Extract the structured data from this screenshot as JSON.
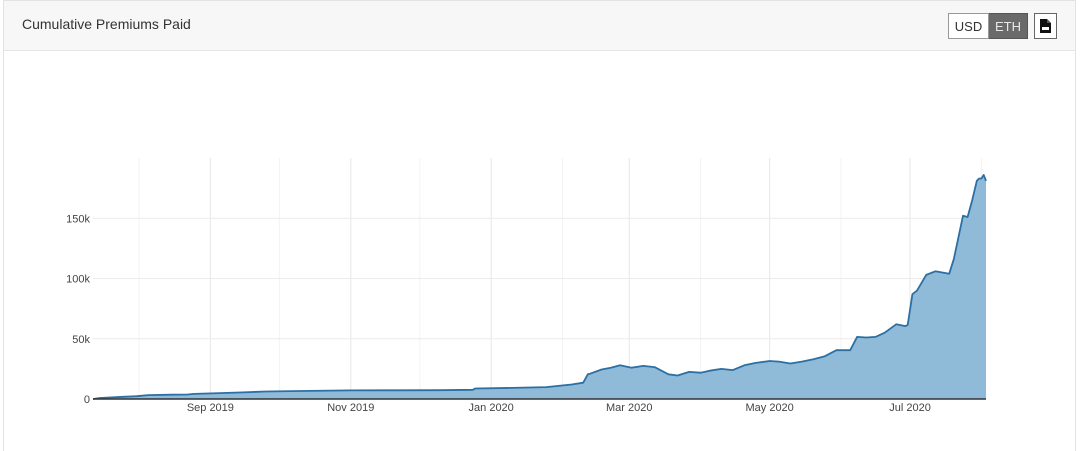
{
  "header": {
    "title": "Cumulative Premiums Paid",
    "currency_buttons": [
      {
        "label": "USD",
        "active": false
      },
      {
        "label": "ETH",
        "active": true
      }
    ],
    "csv_icon": "csv-file-icon"
  },
  "colors": {
    "area_fill": "#8fbbd9",
    "line": "#2c6fa3",
    "grid": "#ececec"
  },
  "chart_data": {
    "type": "area",
    "title": "",
    "xlabel": "",
    "ylabel": "",
    "x_tick_labels": [
      "Sep 2019",
      "Nov 2019",
      "Jan 2020",
      "Mar 2020",
      "May 2020",
      "Jul 2020"
    ],
    "y_tick_labels": [
      "0",
      "50k",
      "100k",
      "150k"
    ],
    "y_ticks": [
      0,
      50000,
      100000,
      150000
    ],
    "ylim": [
      0,
      200000
    ],
    "xlim": [
      "2019-07-12",
      "2020-08-03"
    ],
    "grid": true,
    "series": [
      {
        "x": [
          "2019-07-12",
          "2019-07-15",
          "2019-07-20",
          "2019-07-25",
          "2019-07-31",
          "2019-08-05",
          "2019-08-15",
          "2019-08-22",
          "2019-08-25",
          "2019-09-05",
          "2019-09-15",
          "2019-09-25",
          "2019-10-10",
          "2019-11-01",
          "2019-11-20",
          "2019-12-10",
          "2019-12-24",
          "2019-12-25",
          "2020-01-10",
          "2020-01-25",
          "2020-02-05",
          "2020-02-10",
          "2020-02-12",
          "2020-02-13",
          "2020-02-18",
          "2020-02-22",
          "2020-02-26",
          "2020-03-02",
          "2020-03-07",
          "2020-03-12",
          "2020-03-18",
          "2020-03-22",
          "2020-03-27",
          "2020-04-01",
          "2020-04-05",
          "2020-04-10",
          "2020-04-15",
          "2020-04-20",
          "2020-04-25",
          "2020-05-01",
          "2020-05-05",
          "2020-05-10",
          "2020-05-15",
          "2020-05-20",
          "2020-05-25",
          "2020-05-30",
          "2020-06-05",
          "2020-06-08",
          "2020-06-12",
          "2020-06-16",
          "2020-06-20",
          "2020-06-25",
          "2020-06-29",
          "2020-06-30",
          "2020-07-02",
          "2020-07-04",
          "2020-07-08",
          "2020-07-12",
          "2020-07-15",
          "2020-07-18",
          "2020-07-20",
          "2020-07-24",
          "2020-07-26",
          "2020-07-28",
          "2020-07-30",
          "2020-07-31",
          "2020-08-01",
          "2020-08-02",
          "2020-08-03"
        ],
        "y": [
          0,
          800,
          1300,
          1800,
          2300,
          3200,
          3600,
          3700,
          4200,
          4900,
          5500,
          6200,
          6600,
          7100,
          7200,
          7300,
          7600,
          8700,
          9200,
          9900,
          12000,
          13500,
          20500,
          21000,
          24500,
          26000,
          28000,
          26000,
          27500,
          26500,
          20500,
          19500,
          22500,
          21800,
          23500,
          25000,
          24000,
          28000,
          30000,
          31500,
          31000,
          29500,
          31000,
          33000,
          35500,
          40500,
          40500,
          51500,
          51000,
          51500,
          55000,
          62000,
          60500,
          61500,
          87000,
          90000,
          103000,
          106000,
          105000,
          104000,
          116000,
          152000,
          151000,
          165000,
          181000,
          183000,
          183000,
          186000,
          181000
        ]
      }
    ]
  }
}
